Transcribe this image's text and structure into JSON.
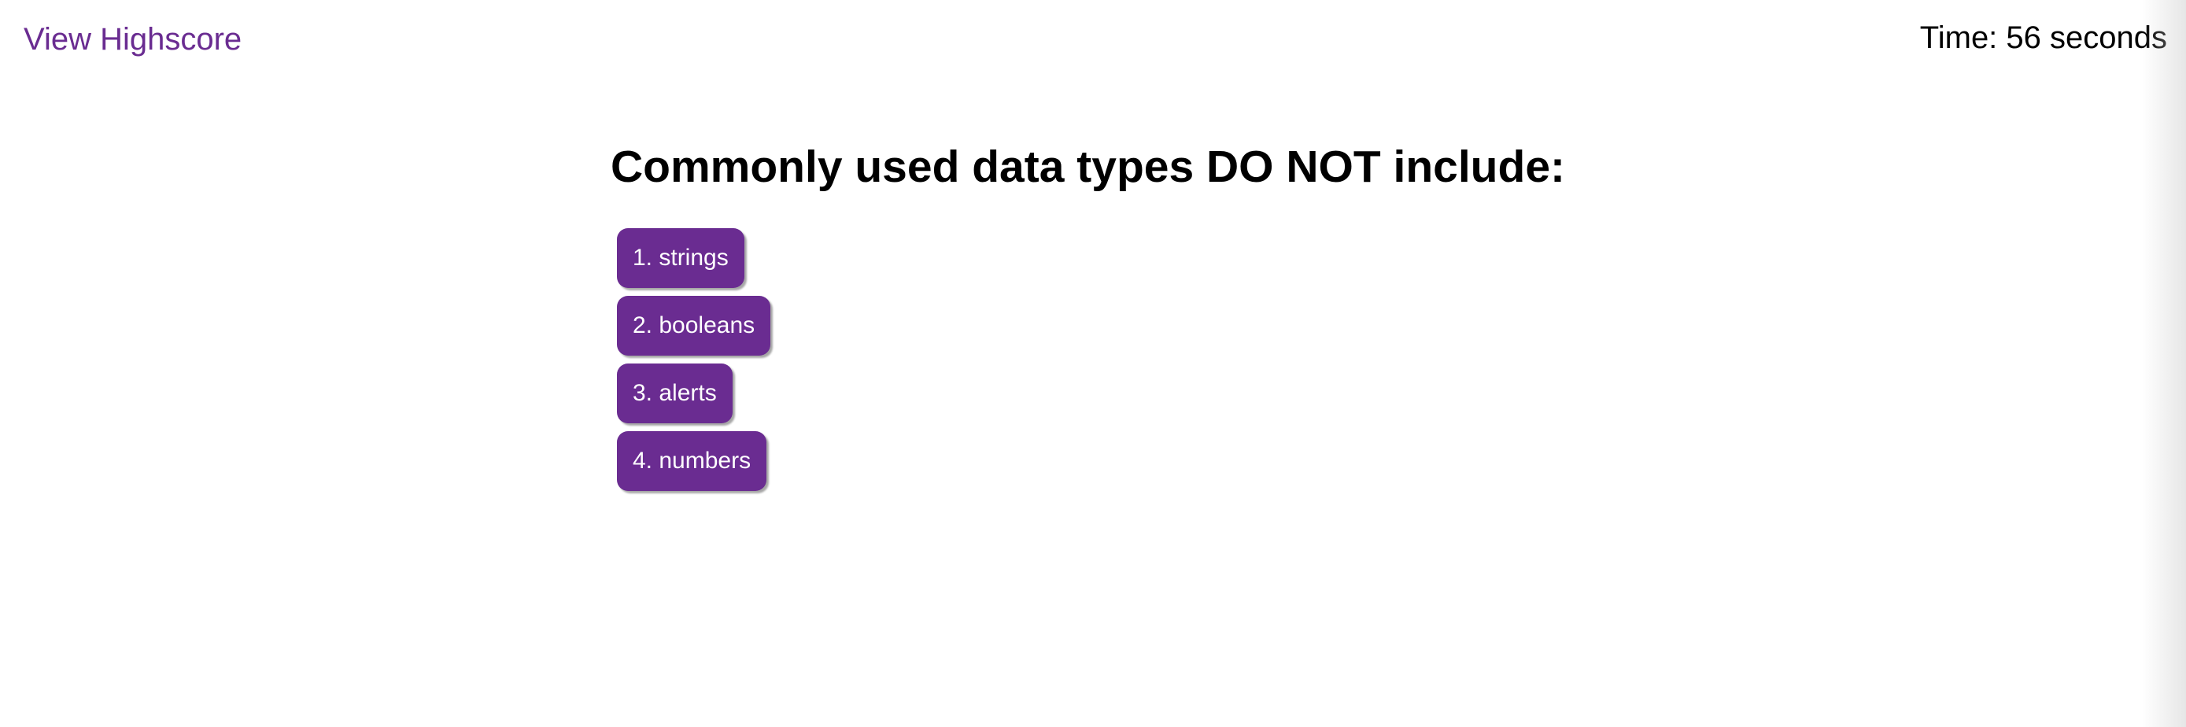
{
  "header": {
    "highscore_link": "View Highscore",
    "timer": "Time: 56 seconds"
  },
  "quiz": {
    "question": "Commonly used data types DO NOT include:",
    "choices": [
      {
        "label": "1. strings"
      },
      {
        "label": "2. booleans"
      },
      {
        "label": "3. alerts"
      },
      {
        "label": "4. numbers"
      }
    ]
  },
  "colors": {
    "accent": "#6a2c91",
    "text": "#000000",
    "background": "#ffffff"
  }
}
